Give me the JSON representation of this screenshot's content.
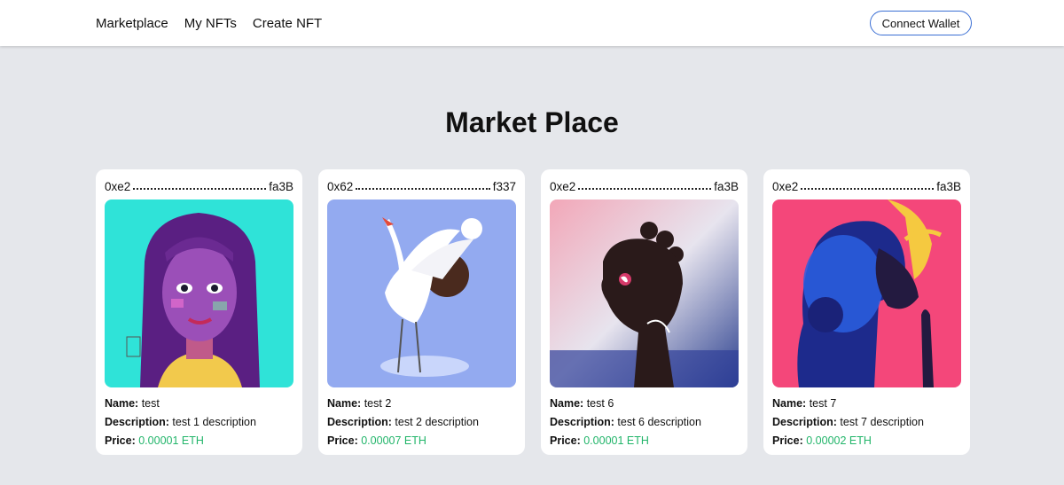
{
  "nav": {
    "links": [
      "Marketplace",
      "My NFTs",
      "Create NFT"
    ],
    "connect_label": "Connect Wallet"
  },
  "page": {
    "title": "Market Place"
  },
  "labels": {
    "name": "Name:",
    "description": "Description:",
    "price": "Price:"
  },
  "colors": {
    "price": "#22b56a",
    "button_border": "#3b6fd4",
    "background": "#e5e7eb"
  },
  "cards": [
    {
      "addr_start": "0xe2",
      "addr_end": "fa3B",
      "name": "test",
      "description": "test 1 description",
      "price": "0.00001 ETH",
      "image": "purple-girl-portrait"
    },
    {
      "addr_start": "0x62",
      "addr_end": "f337",
      "name": "test 2",
      "description": "test 2 description",
      "price": "0.00007 ETH",
      "image": "white-crane"
    },
    {
      "addr_start": "0xe2",
      "addr_end": "fa3B",
      "name": "test 6",
      "description": "test 6 description",
      "price": "0.00001 ETH",
      "image": "profile-woman-buns"
    },
    {
      "addr_start": "0xe2",
      "addr_end": "fa3B",
      "name": "test 7",
      "description": "test 7 description",
      "price": "0.00002 ETH",
      "image": "blue-hair-woman-pink"
    }
  ]
}
